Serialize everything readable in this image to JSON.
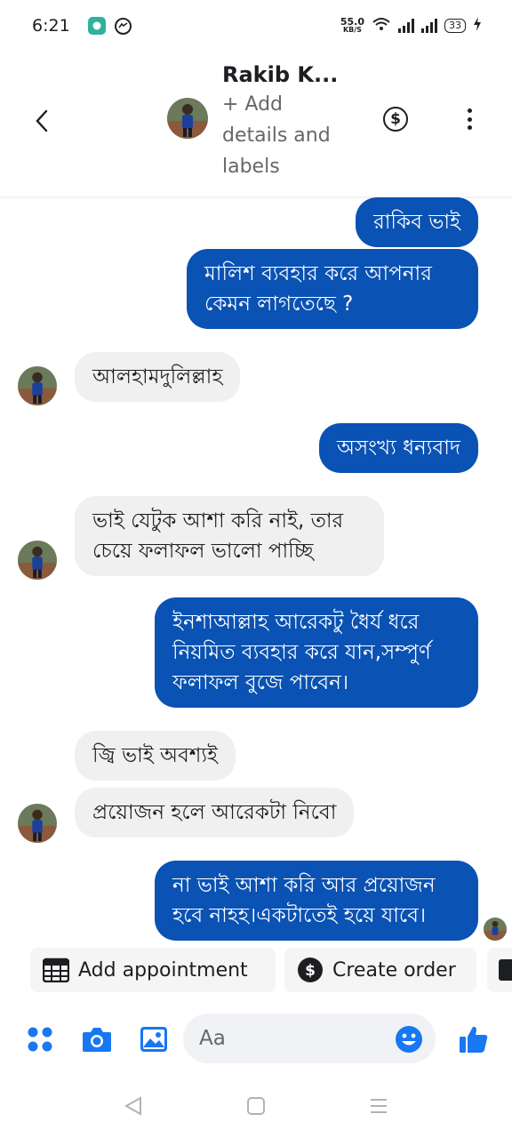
{
  "status_bar": {
    "time": "6:21",
    "net_speed_value": "55.0",
    "net_speed_unit": "KB/S",
    "battery": "33"
  },
  "header": {
    "contact_name": "Rakib K...",
    "add_details": "+ Add details and labels"
  },
  "messages": [
    {
      "direction": "out",
      "text": "রাকিব ভাই"
    },
    {
      "direction": "out",
      "text": "মালিশ ব্যবহার করে আপনার কেমন লাগতেছে ?"
    },
    {
      "direction": "in",
      "text": "আলহামদুলিল্লাহ"
    },
    {
      "direction": "out",
      "text": "অসংখ্য ধন্যবাদ"
    },
    {
      "direction": "in",
      "text": "ভাই যেটুক আশা করি নাই, তার চেয়ে ফলাফল ভালো পাচ্ছি"
    },
    {
      "direction": "out",
      "text": "ইনশাআল্লাহ আরেকটু ধৈর্য ধরে নিয়মিত ব্যবহার করে যান,সম্পুর্ণ ফলাফল বুজে পাবেন।"
    },
    {
      "direction": "in",
      "text": "জ্বি ভাই অবশ্যই"
    },
    {
      "direction": "in",
      "text": "প্রয়োজন হলে আরেকটা নিবো"
    },
    {
      "direction": "out",
      "text": "না ভাই আশা করি আর প্রয়োজন হবে নাহহ।একটাতেই হয়ে যাবে।"
    }
  ],
  "quick_actions": {
    "appointment": "Add appointment",
    "order": "Create order"
  },
  "composer": {
    "placeholder": "Aa"
  },
  "colors": {
    "outgoing_bubble": "#0a52b3",
    "incoming_bubble": "#f0f0f0",
    "accent": "#1877f2"
  },
  "icons": [
    "back-icon",
    "dollar-icon",
    "more-icon",
    "apps-icon",
    "camera-icon",
    "gallery-icon",
    "emoji-icon",
    "like-icon",
    "calendar-icon",
    "nav-back-icon",
    "nav-home-icon",
    "nav-menu-icon"
  ]
}
